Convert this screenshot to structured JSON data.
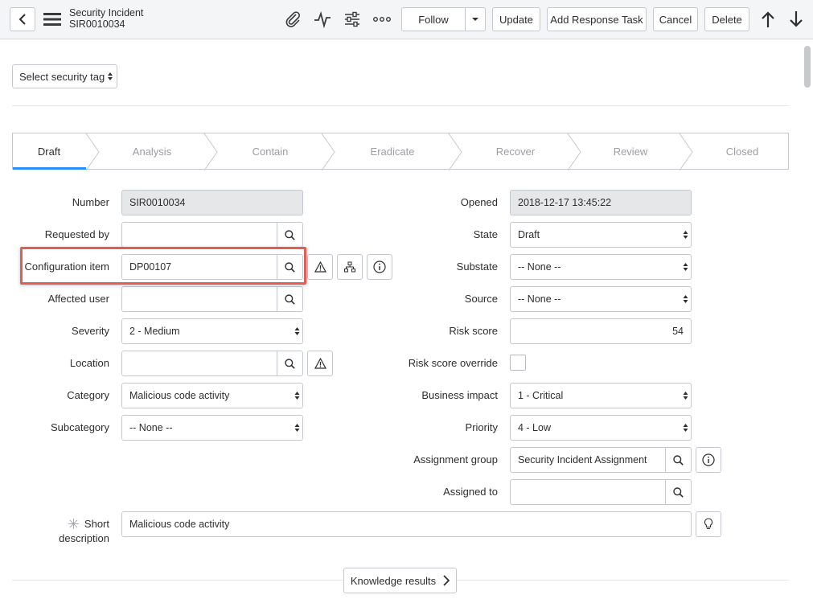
{
  "header": {
    "title": "Security Incident",
    "record_number": "SIR0010034",
    "follow_label": "Follow",
    "buttons": [
      "Update",
      "Add Response Task",
      "Cancel",
      "Delete"
    ]
  },
  "security_tag": {
    "label": "Select security tag"
  },
  "process_stages": [
    "Draft",
    "Analysis",
    "Contain",
    "Eradicate",
    "Recover",
    "Review",
    "Closed"
  ],
  "active_stage": "Draft",
  "left_fields": {
    "number": {
      "label": "Number",
      "value": "SIR0010034"
    },
    "requested_by": {
      "label": "Requested by",
      "value": ""
    },
    "configuration_item": {
      "label": "Configuration item",
      "value": "DP00107"
    },
    "affected_user": {
      "label": "Affected user",
      "value": ""
    },
    "severity": {
      "label": "Severity",
      "value": "2 - Medium"
    },
    "location": {
      "label": "Location",
      "value": ""
    },
    "category": {
      "label": "Category",
      "value": "Malicious code activity"
    },
    "subcategory": {
      "label": "Subcategory",
      "value": "-- None --"
    }
  },
  "right_fields": {
    "opened": {
      "label": "Opened",
      "value": "2018-12-17 13:45:22"
    },
    "state": {
      "label": "State",
      "value": "Draft"
    },
    "substate": {
      "label": "Substate",
      "value": "-- None --"
    },
    "source": {
      "label": "Source",
      "value": "-- None --"
    },
    "risk_score": {
      "label": "Risk score",
      "value": "54"
    },
    "risk_score_override": {
      "label": "Risk score override",
      "checked": false
    },
    "business_impact": {
      "label": "Business impact",
      "value": "1 - Critical"
    },
    "priority": {
      "label": "Priority",
      "value": "4 - Low"
    },
    "assignment_group": {
      "label": "Assignment group",
      "value": "Security Incident Assignment"
    },
    "assigned_to": {
      "label": "Assigned to",
      "value": ""
    }
  },
  "short_description": {
    "label_line1": "Short",
    "label_line2": "description",
    "value": "Malicious code activity"
  },
  "knowledge_results": {
    "label": "Knowledge results"
  },
  "colors": {
    "accent": "#278efc",
    "highlight": "#e25d56"
  }
}
